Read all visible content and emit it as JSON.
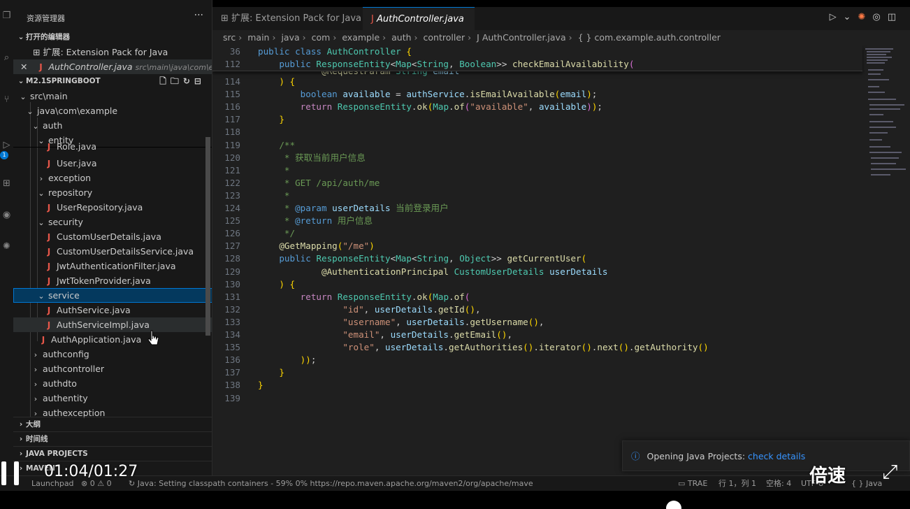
{
  "explorer": {
    "title": "资源管理器",
    "more": "···",
    "open_editors_label": "打开的编辑器",
    "open_editors": [
      {
        "icon": "extension-icon",
        "label": "扩展: Extension Pack for Java",
        "path": ""
      },
      {
        "icon": "java-file-icon",
        "label": "AuthController.java",
        "path": "src\\main\\java\\com\\exa..."
      }
    ],
    "project_label": "M2.1SPRINGBOOT",
    "tree": [
      {
        "label": "src\\main",
        "icon": "chevron-down"
      },
      {
        "label": "java\\com\\example",
        "icon": "chevron-down"
      },
      {
        "label": "auth",
        "icon": "chevron-down"
      },
      {
        "label": "entity",
        "icon": "chevron-down"
      },
      {
        "label": "Role.java",
        "icon": "java"
      },
      {
        "label": "User.java",
        "icon": "java"
      },
      {
        "label": "exception",
        "icon": "chevron-right"
      },
      {
        "label": "repository",
        "icon": "chevron-down"
      },
      {
        "label": "UserRepository.java",
        "icon": "java"
      },
      {
        "label": "security",
        "icon": "chevron-down"
      },
      {
        "label": "CustomUserDetails.java",
        "icon": "java"
      },
      {
        "label": "CustomUserDetailsService.java",
        "icon": "java"
      },
      {
        "label": "JwtAuthenticationFilter.java",
        "icon": "java"
      },
      {
        "label": "JwtTokenProvider.java",
        "icon": "java"
      },
      {
        "label": "service",
        "icon": "chevron-down"
      },
      {
        "label": "AuthService.java",
        "icon": "java"
      },
      {
        "label": "AuthServiceImpl.java",
        "icon": "java"
      },
      {
        "label": "AuthApplication.java",
        "icon": "java"
      },
      {
        "label": "authconfig",
        "icon": "chevron-right"
      },
      {
        "label": "authcontroller",
        "icon": "chevron-right"
      },
      {
        "label": "authdto",
        "icon": "chevron-right"
      },
      {
        "label": "authentity",
        "icon": "chevron-right"
      },
      {
        "label": "authexception",
        "icon": "chevron-right"
      }
    ],
    "sections": [
      "大纲",
      "时间线",
      "JAVA PROJECTS",
      "MAVEN"
    ]
  },
  "tabs": [
    {
      "label": "扩展: Extension Pack for Java",
      "active": false
    },
    {
      "label": "AuthController.java",
      "active": true
    }
  ],
  "breadcrumb": [
    "src",
    "main",
    "java",
    "com",
    "example",
    "auth",
    "controller",
    "AuthController.java",
    "{ } com.example.auth.controller"
  ],
  "editor": {
    "sticky_lines": [
      {
        "n": "36",
        "code": "public class AuthController {"
      },
      {
        "n": "112",
        "code": "    public ResponseEntity<Map<String, Boolean>> checkEmailAvailability("
      }
    ],
    "lines": [
      {
        "n": "114",
        "code": "    ) {"
      },
      {
        "n": "115",
        "code": "        boolean available = authService.isEmailAvailable(email);"
      },
      {
        "n": "116",
        "code": "        return ResponseEntity.ok(Map.of(\"available\", available));"
      },
      {
        "n": "117",
        "code": "    }"
      },
      {
        "n": "118",
        "code": ""
      },
      {
        "n": "119",
        "code": "    /**"
      },
      {
        "n": "120",
        "code": "     * 获取当前用户信息"
      },
      {
        "n": "121",
        "code": "     *"
      },
      {
        "n": "122",
        "code": "     * GET /api/auth/me"
      },
      {
        "n": "123",
        "code": "     *"
      },
      {
        "n": "124",
        "code": "     * @param userDetails 当前登录用户"
      },
      {
        "n": "125",
        "code": "     * @return 用户信息"
      },
      {
        "n": "126",
        "code": "     */"
      },
      {
        "n": "127",
        "code": "    @GetMapping(\"/me\")"
      },
      {
        "n": "128",
        "code": "    public ResponseEntity<Map<String, Object>> getCurrentUser("
      },
      {
        "n": "129",
        "code": "            @AuthenticationPrincipal CustomUserDetails userDetails"
      },
      {
        "n": "130",
        "code": "    ) {"
      },
      {
        "n": "131",
        "code": "        return ResponseEntity.ok(Map.of("
      },
      {
        "n": "132",
        "code": "                \"id\", userDetails.getId(),"
      },
      {
        "n": "133",
        "code": "                \"username\", userDetails.getUsername(),"
      },
      {
        "n": "134",
        "code": "                \"email\", userDetails.getEmail(),"
      },
      {
        "n": "135",
        "code": "                \"role\", userDetails.getAuthorities().iterator().next().getAuthority()"
      },
      {
        "n": "136",
        "code": "        ));"
      },
      {
        "n": "137",
        "code": "    }"
      },
      {
        "n": "138",
        "code": "}"
      },
      {
        "n": "139",
        "code": ""
      }
    ]
  },
  "notification": {
    "text": "Opening Java Projects: ",
    "link": "check details"
  },
  "status": {
    "launchpad": "Launchpad",
    "problems": "⊗ 0 ⚠ 0",
    "java": "↻ Java: Setting classpath containers - 59% 0% https://repo.maven.apache.org/maven2/org/apache/mave",
    "trae": "TRAE",
    "position": "行 1，列 1",
    "spaces": "空格: 4",
    "encoding": "UTF-8",
    "braces": "{ }",
    "language": "Java"
  },
  "video": {
    "time": "01:04/01:27",
    "speed": "倍速"
  },
  "colors": {
    "accent": "#0078d4",
    "error": "#e8574a",
    "link": "#3794ff"
  }
}
